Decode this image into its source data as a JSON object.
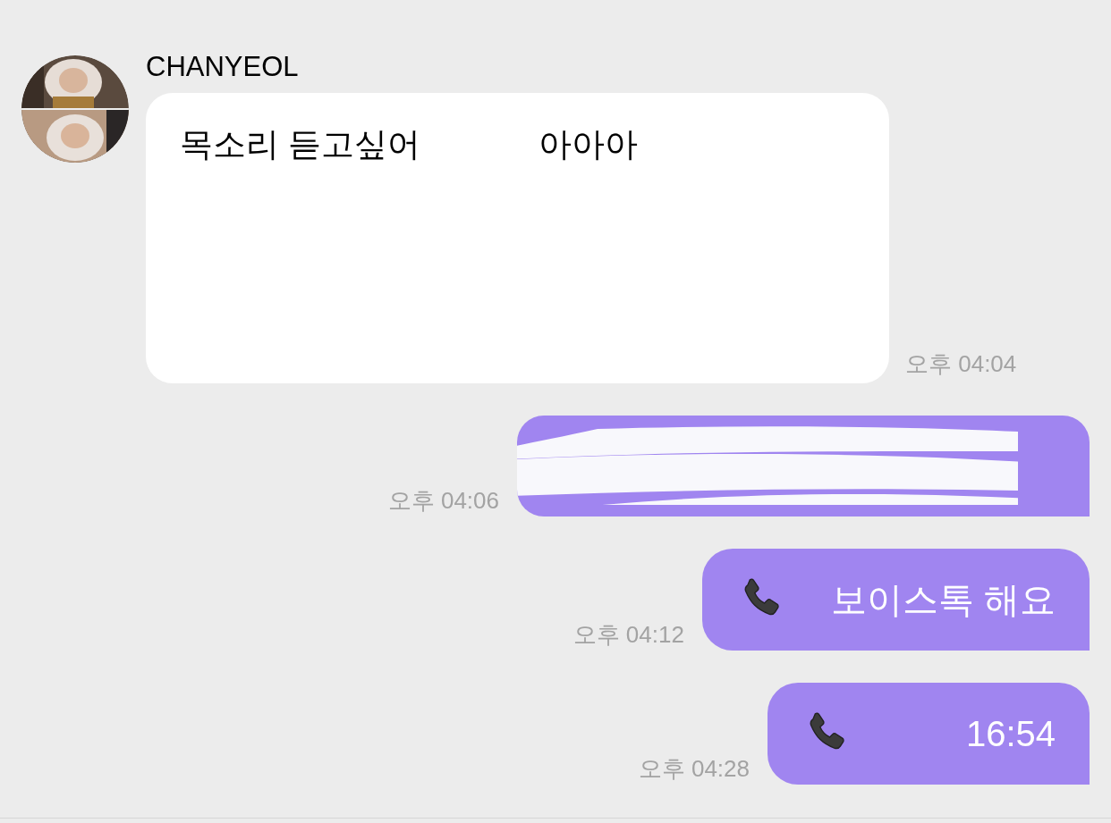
{
  "contact": {
    "name": "CHANYEOL"
  },
  "messages": [
    {
      "kind": "received",
      "lines": [
        "목소리 듣고싶어",
        "아아아"
      ],
      "time": "오후 04:04"
    },
    {
      "kind": "redacted",
      "time": "오후 04:06"
    },
    {
      "kind": "call",
      "text": "보이스톡 해요",
      "time": "오후 04:12"
    },
    {
      "kind": "call",
      "text": "16:54",
      "time": "오후 04:28"
    }
  ]
}
